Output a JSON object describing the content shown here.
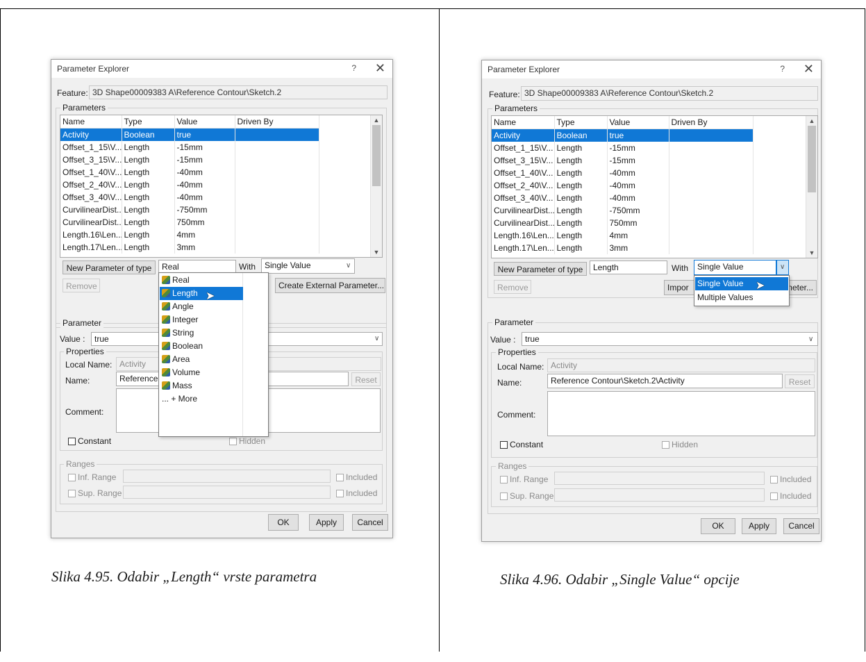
{
  "left": {
    "title": "Parameter Explorer",
    "help": "?",
    "close": "✕",
    "feature_label": "Feature:",
    "feature_value": "3D Shape00009383 A\\Reference Contour\\Sketch.2",
    "parameters_group": "Parameters",
    "columns": [
      "Name",
      "Type",
      "Value",
      "Driven By"
    ],
    "rows": [
      [
        "Activity",
        "Boolean",
        "true",
        ""
      ],
      [
        "Offset_1_15\\V...",
        "Length",
        "-15mm",
        ""
      ],
      [
        "Offset_3_15\\V...",
        "Length",
        "-15mm",
        ""
      ],
      [
        "Offset_1_40\\V...",
        "Length",
        "-40mm",
        ""
      ],
      [
        "Offset_2_40\\V...",
        "Length",
        "-40mm",
        ""
      ],
      [
        "Offset_3_40\\V...",
        "Length",
        "-40mm",
        ""
      ],
      [
        "CurvilinearDist...",
        "Length",
        "-750mm",
        ""
      ],
      [
        "CurvilinearDist...",
        "Length",
        "750mm",
        ""
      ],
      [
        "Length.16\\Len...",
        "Length",
        "4mm",
        ""
      ],
      [
        "Length.17\\Len...",
        "Length",
        "3mm",
        ""
      ]
    ],
    "new_param_button": "New Parameter of type",
    "type_value": "Real",
    "with_label": "With",
    "with_value": "Single Value",
    "remove_button": "Remove",
    "create_external_button": "Create External Parameter...",
    "dropdown_items": [
      "Real",
      "Length",
      "Angle",
      "Integer",
      "String",
      "Boolean",
      "Area",
      "Volume",
      "Mass",
      "... + More"
    ],
    "parameter_group": "Parameter",
    "value_label": "Value :",
    "value_value": "true",
    "properties_group": "Properties",
    "local_name_label": "Local Name:",
    "local_name_value": "Activity",
    "name_label": "Name:",
    "name_value": "Reference",
    "reset_button": "Reset",
    "comment_label": "Comment:",
    "constant_label": "Constant",
    "hidden_label": "Hidden",
    "ranges_group": "Ranges",
    "inf_range_label": "Inf. Range",
    "sup_range_label": "Sup. Range",
    "included_label": "Included",
    "ok_button": "OK",
    "apply_button": "Apply",
    "cancel_button": "Cancel"
  },
  "right": {
    "title": "Parameter Explorer",
    "help": "?",
    "close": "✕",
    "feature_label": "Feature:",
    "feature_value": "3D Shape00009383 A\\Reference Contour\\Sketch.2",
    "parameters_group": "Parameters",
    "columns": [
      "Name",
      "Type",
      "Value",
      "Driven By"
    ],
    "rows": [
      [
        "Activity",
        "Boolean",
        "true",
        ""
      ],
      [
        "Offset_1_15\\V...",
        "Length",
        "-15mm",
        ""
      ],
      [
        "Offset_3_15\\V...",
        "Length",
        "-15mm",
        ""
      ],
      [
        "Offset_1_40\\V...",
        "Length",
        "-40mm",
        ""
      ],
      [
        "Offset_2_40\\V...",
        "Length",
        "-40mm",
        ""
      ],
      [
        "Offset_3_40\\V...",
        "Length",
        "-40mm",
        ""
      ],
      [
        "CurvilinearDist...",
        "Length",
        "-750mm",
        ""
      ],
      [
        "CurvilinearDist...",
        "Length",
        "750mm",
        ""
      ],
      [
        "Length.16\\Len...",
        "Length",
        "4mm",
        ""
      ],
      [
        "Length.17\\Len...",
        "Length",
        "3mm",
        ""
      ]
    ],
    "new_param_button": "New Parameter of type",
    "type_value": "Length",
    "with_label": "With",
    "with_value": "Single Value",
    "remove_button": "Remove",
    "import_partial": "Impor",
    "create_partial": "neter...",
    "dropdown_items": [
      "Single Value",
      "Multiple Values"
    ],
    "parameter_group": "Parameter",
    "value_label": "Value :",
    "value_value": "true",
    "properties_group": "Properties",
    "local_name_label": "Local Name:",
    "local_name_value": "Activity",
    "name_label": "Name:",
    "name_value": "Reference Contour\\Sketch.2\\Activity",
    "reset_button": "Reset",
    "comment_label": "Comment:",
    "constant_label": "Constant",
    "hidden_label": "Hidden",
    "ranges_group": "Ranges",
    "inf_range_label": "Inf. Range",
    "sup_range_label": "Sup. Range",
    "included_label": "Included",
    "ok_button": "OK",
    "apply_button": "Apply",
    "cancel_button": "Cancel"
  },
  "captions": {
    "left": "Slika 4.95. Odabir „Length“ vrste parametra",
    "right": "Slika 4.96. Odabir „Single Value“ opcije"
  },
  "colors": {
    "selection": "#1078d6",
    "dialog_bg": "#f0f0f0"
  },
  "icons": {
    "parameter_type": "parameter-type-icon",
    "cursor": "mouse-pointer-icon"
  }
}
